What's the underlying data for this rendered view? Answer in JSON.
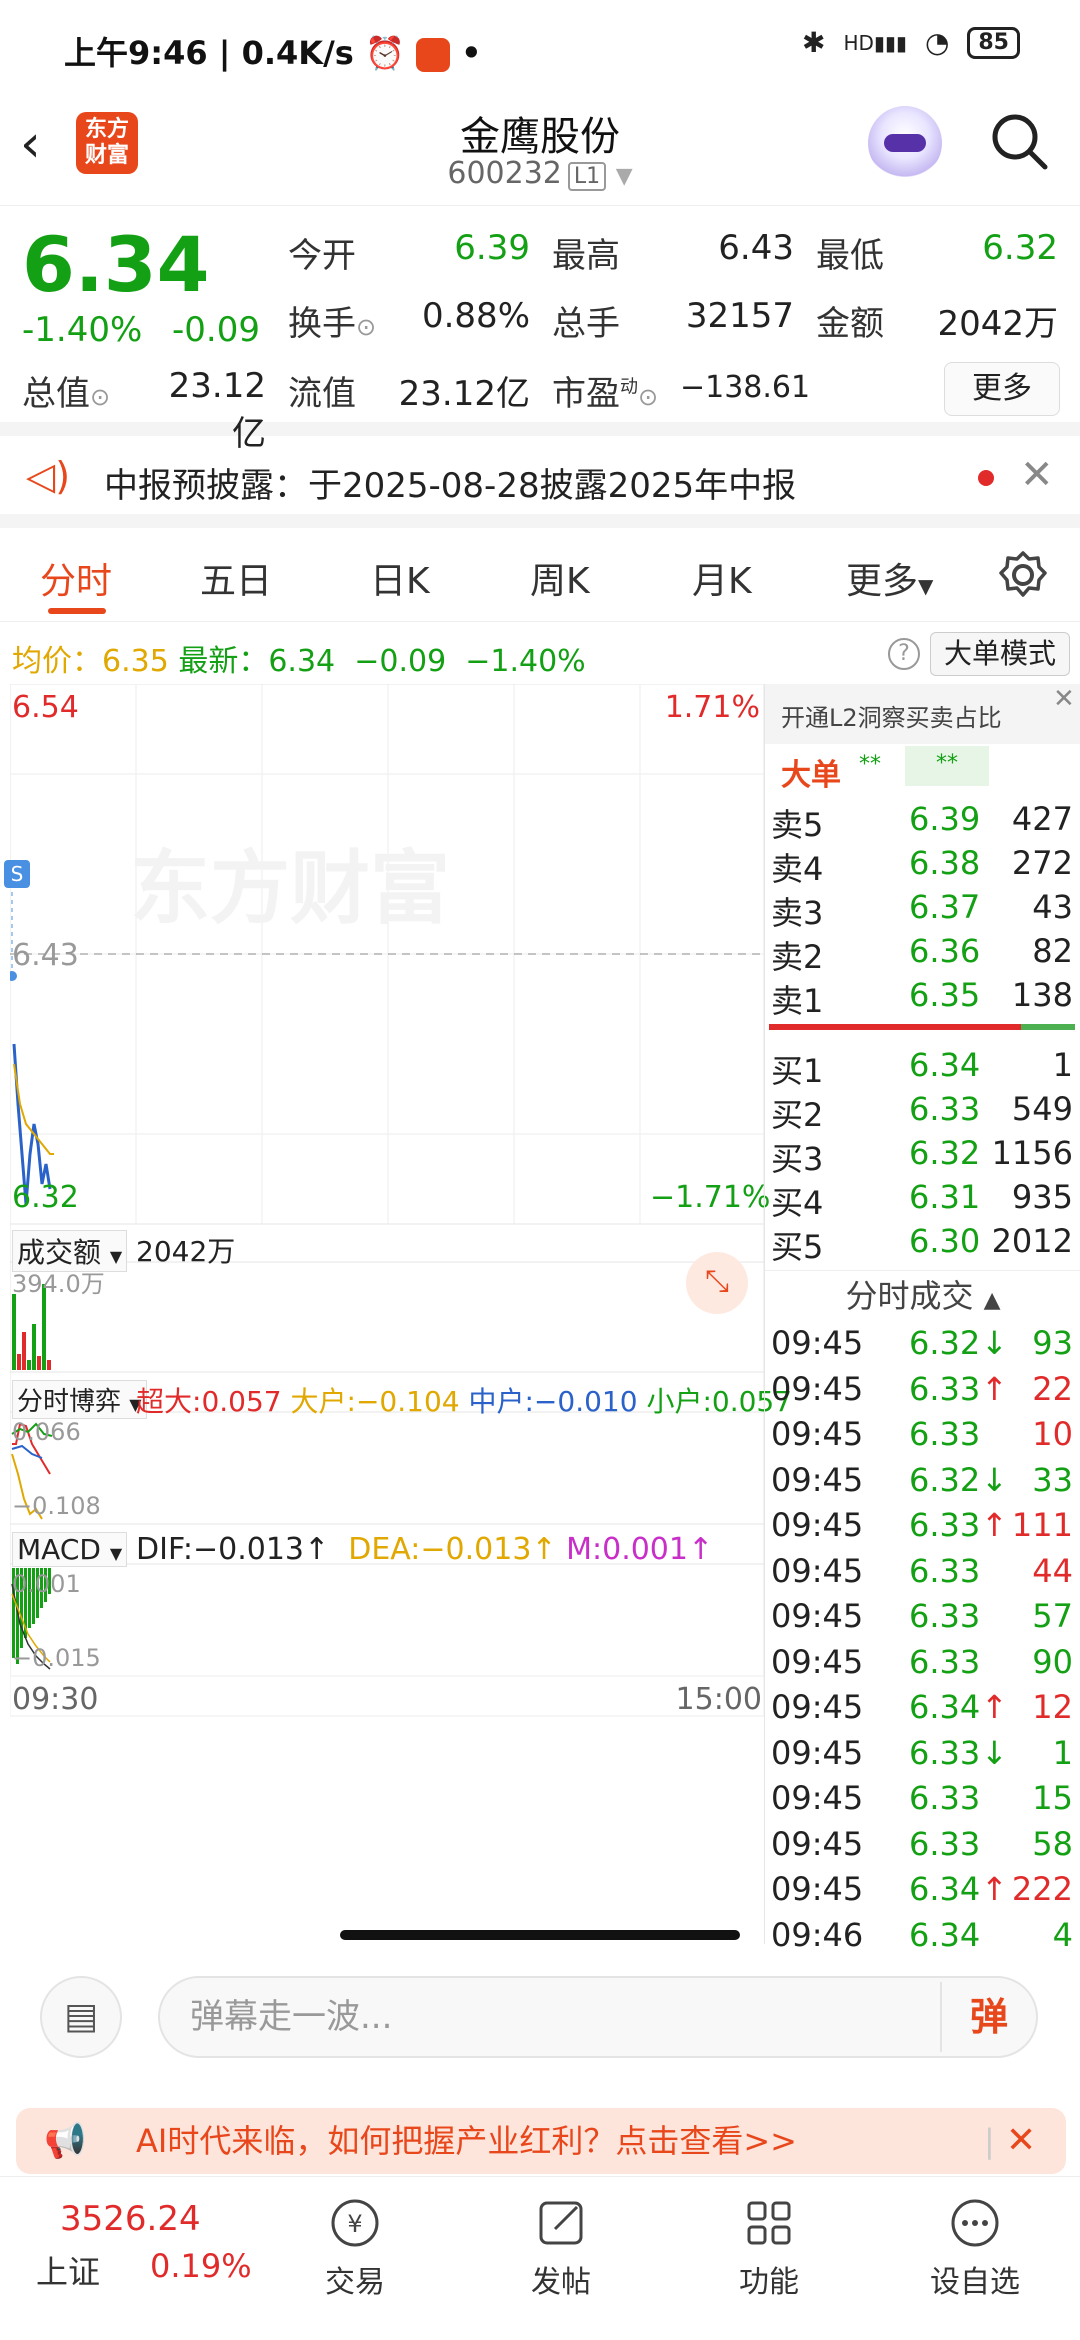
{
  "status_bar": {
    "time": "上午9:46",
    "speed": "0.4K/s",
    "battery": "85",
    "network": "HD"
  },
  "header": {
    "logo_text": "东方\n财富",
    "title": "金鹰股份",
    "code": "600232",
    "level": "L1"
  },
  "quote": {
    "price": "6.34",
    "change_pct": "-1.40%",
    "change": "-0.09",
    "rows": [
      [
        {
          "label": "今开",
          "value": "6.39",
          "color": "green"
        },
        {
          "label": "最高",
          "value": "6.43",
          "color": "default"
        },
        {
          "label": "最低",
          "value": "6.32",
          "color": "green"
        }
      ],
      [
        {
          "label": "换手",
          "value": "0.88%",
          "color": "default"
        },
        {
          "label": "总手",
          "value": "32157",
          "color": "default"
        },
        {
          "label": "金额",
          "value": "2042万",
          "color": "default"
        }
      ]
    ],
    "total_value_label": "总值",
    "total_value": "23.12亿",
    "float_value_label": "流值",
    "float_value": "23.12亿",
    "pe_label": "市盈",
    "pe_sup": "动",
    "pe_value": "−138.61",
    "more_button": "更多"
  },
  "notice": {
    "text": "中报预披露：于2025-08-28披露2025年中报"
  },
  "tabs": [
    "分时",
    "五日",
    "日K",
    "周K",
    "月K",
    "更多"
  ],
  "active_tab": "分时",
  "avg_line": {
    "avg_label": "均价：",
    "avg_value": "6.35",
    "latest_label": "最新：",
    "latest_value": "6.34",
    "change": "−0.09",
    "change_pct": "−1.40%",
    "mode_button": "大单模式"
  },
  "price_chart": {
    "top_price": "6.54",
    "top_pct": "1.71%",
    "mid_price": "6.43",
    "bottom_price": "6.32",
    "bottom_pct": "−1.71%",
    "watermark": "东方财富",
    "s_marker": "S"
  },
  "volume_panel": {
    "label": "成交额",
    "value": "2042万",
    "max_value": "394.0万"
  },
  "flow_panel": {
    "label": "分时博弈",
    "items": [
      {
        "name": "超大:",
        "value": "0.057",
        "color": "#e12b2b"
      },
      {
        "name": "大户:",
        "value": "−0.104",
        "color": "#e0a800"
      },
      {
        "name": "中户:",
        "value": "−0.010",
        "color": "#2a62c9"
      },
      {
        "name": "小户:",
        "value": "0.057",
        "color": "#14a014"
      }
    ],
    "top_value": "0.066",
    "bottom_value": "−0.108"
  },
  "macd_panel": {
    "label": "MACD",
    "dif": "DIF:−0.013",
    "dea": "DEA:−0.013",
    "m": "M:0.001",
    "top_value": "0.001",
    "bottom_value": "−0.015"
  },
  "time_axis": {
    "start": "09:30",
    "end": "15:00"
  },
  "order_book": {
    "l2_text": "开通L2洞察买卖占比",
    "big_order_label": "大单",
    "big_order_mask": "**",
    "asks": [
      {
        "label": "卖5",
        "price": "6.39",
        "vol": "427",
        "color": "green"
      },
      {
        "label": "卖4",
        "price": "6.38",
        "vol": "272",
        "color": "green"
      },
      {
        "label": "卖3",
        "price": "6.37",
        "vol": "43",
        "color": "green"
      },
      {
        "label": "卖2",
        "price": "6.36",
        "vol": "82",
        "color": "green"
      },
      {
        "label": "卖1",
        "price": "6.35",
        "vol": "138",
        "color": "green"
      }
    ],
    "bids": [
      {
        "label": "买1",
        "price": "6.34",
        "vol": "1",
        "color": "green"
      },
      {
        "label": "买2",
        "price": "6.33",
        "vol": "549",
        "color": "green"
      },
      {
        "label": "买3",
        "price": "6.32",
        "vol": "1156",
        "color": "green"
      },
      {
        "label": "买4",
        "price": "6.31",
        "vol": "935",
        "color": "green"
      },
      {
        "label": "买5",
        "price": "6.30",
        "vol": "2012",
        "color": "green"
      }
    ]
  },
  "ticks": {
    "title": "分时成交",
    "rows": [
      {
        "time": "09:45",
        "price": "6.32",
        "arrow": "↓",
        "vol": "93",
        "vcolor": "green"
      },
      {
        "time": "09:45",
        "price": "6.33",
        "arrow": "↑",
        "vol": "22",
        "vcolor": "red"
      },
      {
        "time": "09:45",
        "price": "6.33",
        "arrow": "",
        "vol": "10",
        "vcolor": "red"
      },
      {
        "time": "09:45",
        "price": "6.32",
        "arrow": "↓",
        "vol": "33",
        "vcolor": "green"
      },
      {
        "time": "09:45",
        "price": "6.33",
        "arrow": "↑",
        "vol": "111",
        "vcolor": "red"
      },
      {
        "time": "09:45",
        "price": "6.33",
        "arrow": "",
        "vol": "44",
        "vcolor": "red"
      },
      {
        "time": "09:45",
        "price": "6.33",
        "arrow": "",
        "vol": "57",
        "vcolor": "green"
      },
      {
        "time": "09:45",
        "price": "6.33",
        "arrow": "",
        "vol": "90",
        "vcolor": "green"
      },
      {
        "time": "09:45",
        "price": "6.34",
        "arrow": "↑",
        "vol": "12",
        "vcolor": "red"
      },
      {
        "time": "09:45",
        "price": "6.33",
        "arrow": "↓",
        "vol": "1",
        "vcolor": "green"
      },
      {
        "time": "09:45",
        "price": "6.33",
        "arrow": "",
        "vol": "15",
        "vcolor": "green"
      },
      {
        "time": "09:45",
        "price": "6.33",
        "arrow": "",
        "vol": "58",
        "vcolor": "green"
      },
      {
        "time": "09:45",
        "price": "6.34",
        "arrow": "↑",
        "vol": "222",
        "vcolor": "red"
      },
      {
        "time": "09:46",
        "price": "6.34",
        "arrow": "",
        "vol": "4",
        "vcolor": "green"
      }
    ]
  },
  "danmaku": {
    "placeholder": "弹幕走一波...",
    "send_label": "弹"
  },
  "ad": {
    "text": "AI时代来临，如何把握产业红利？点击查看>>"
  },
  "bottom_nav": {
    "index_value": "3526.24",
    "index_name": "上证",
    "index_pct": "0.19%",
    "items": [
      "交易",
      "发帖",
      "功能",
      "设自选"
    ]
  }
}
